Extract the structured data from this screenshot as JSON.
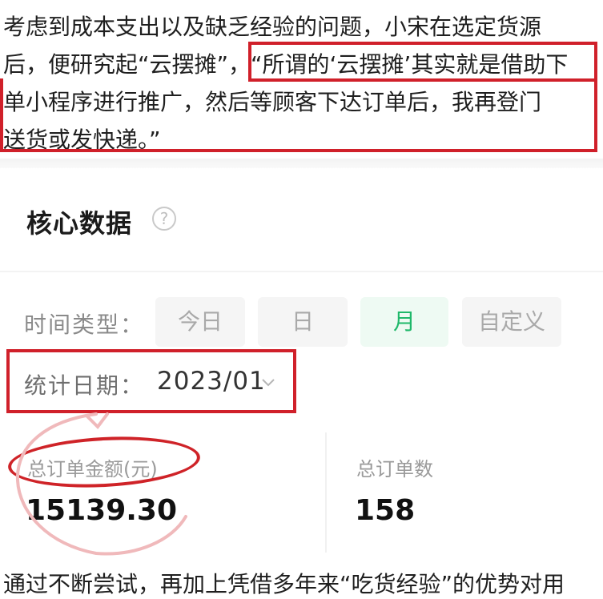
{
  "article": {
    "lines": [
      "考虑到成本支出以及缺乏经验的问题，小宋在选定货源",
      "后，便研究起“云摆摊”，“所谓的‘云摆摊’其实就是借助下",
      "单小程序进行推广，然后等顾客下达订单后，我再登门",
      "送货或发快递。”"
    ],
    "bottom_line": "通过不断尝试，再加上凭借多年来“吃货经验”的优势对用"
  },
  "panel": {
    "title": "核心数据",
    "help_icon": "question-circle-icon",
    "time_type_label": "时间类型：",
    "time_options": [
      "今日",
      "日",
      "月",
      "自定义"
    ],
    "time_selected": "月",
    "date_label": "统计日期：",
    "date_value": "2023/01",
    "stats": [
      {
        "label": "总订单金额(元)",
        "value": "15139.30"
      },
      {
        "label": "总订单数",
        "value": "158"
      }
    ]
  },
  "colors": {
    "annotation_red": "#d0202a",
    "active_green": "#1fb86a"
  }
}
